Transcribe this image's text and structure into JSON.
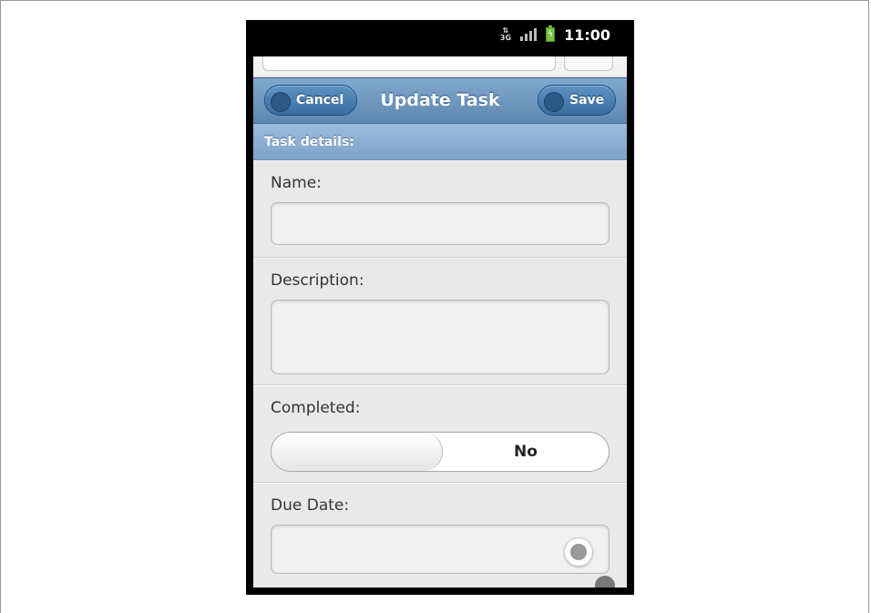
{
  "status_bar": {
    "network_type": "3G",
    "time": "11:00"
  },
  "header": {
    "title": "Update Task",
    "cancel_label": "Cancel",
    "save_label": "Save"
  },
  "form": {
    "section_title": "Task details:",
    "name_label": "Name:",
    "name_value": "",
    "description_label": "Description:",
    "description_value": "",
    "completed_label": "Completed:",
    "completed_value": "No",
    "due_date_label": "Due Date:",
    "due_date_value": ""
  },
  "colors": {
    "header_blue": "#6e97bf",
    "divider_blue": "#8cb0d4",
    "battery_green": "#7bc142"
  }
}
